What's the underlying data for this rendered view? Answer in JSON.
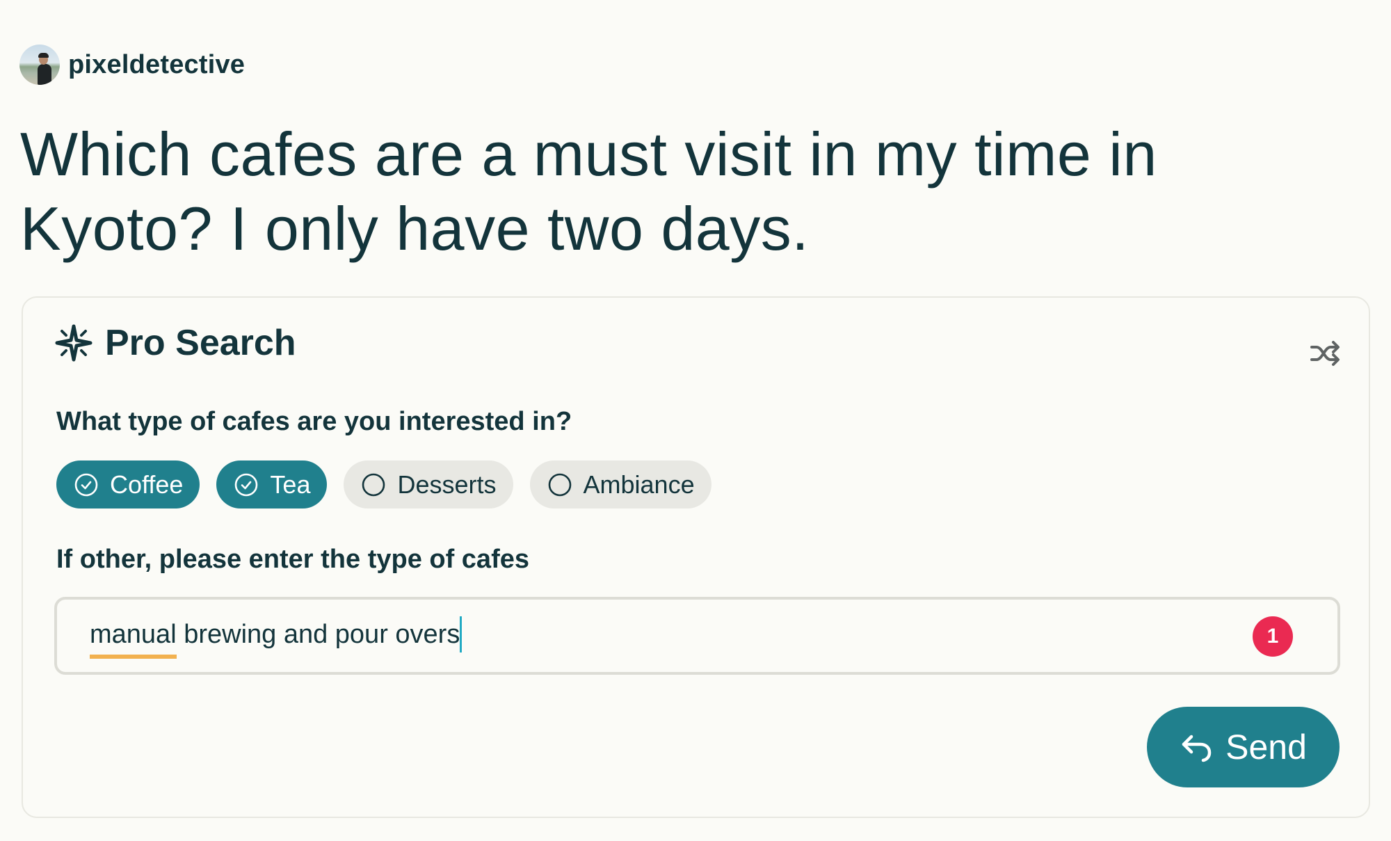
{
  "user": {
    "username": "pixeldetective",
    "avatar_icon": "user-avatar-photo"
  },
  "query": {
    "text": "Which cafes are a must visit in my time in Kyoto? I only have two days."
  },
  "pro_search": {
    "title": "Pro Search",
    "icon": "sparkle-star-icon",
    "shuffle_icon": "shuffle-icon",
    "question_1": "What type of cafes are you interested in?",
    "options": [
      {
        "label": "Coffee",
        "selected": true
      },
      {
        "label": "Tea",
        "selected": true
      },
      {
        "label": "Desserts",
        "selected": false
      },
      {
        "label": "Ambiance",
        "selected": false
      }
    ],
    "question_2": "If other, please enter the type of cafes",
    "input": {
      "value_underlined": "manual",
      "value_rest": " brewing and pour overs",
      "spellcheck_badge": "1"
    },
    "send_label": "Send",
    "send_icon": "reply-arrow-icon"
  },
  "colors": {
    "accent": "#20808d",
    "text": "#13343b",
    "chip_unselected": "#e8e8e3",
    "badge": "#ea2a52",
    "spell_underline": "#f2b14f",
    "caret": "#22aac4",
    "background": "#fbfbf7"
  }
}
